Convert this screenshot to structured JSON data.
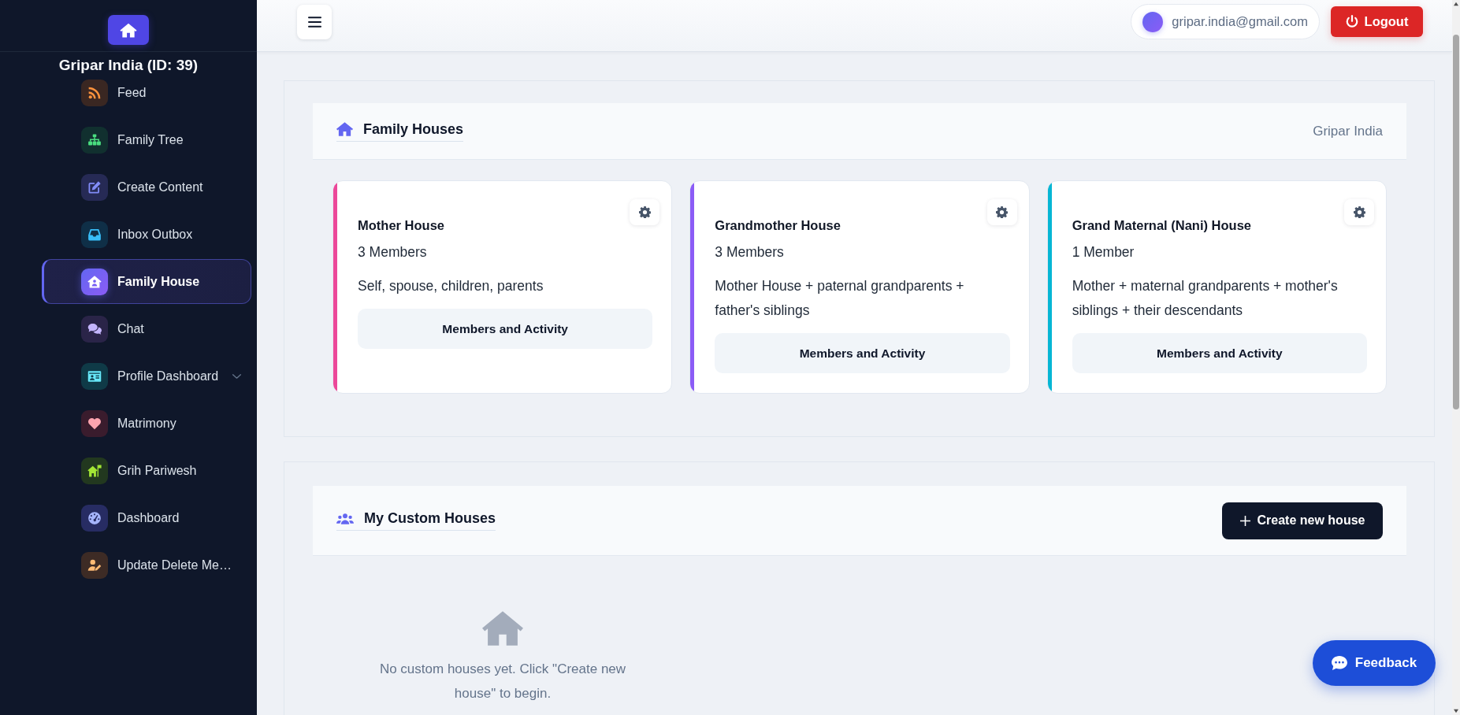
{
  "sidebar": {
    "title": "Gripar India (ID: 39)",
    "items": [
      {
        "label": "Feed",
        "selected": false,
        "has_submenu": false
      },
      {
        "label": "Family Tree",
        "selected": false,
        "has_submenu": false
      },
      {
        "label": "Create Content",
        "selected": false,
        "has_submenu": false
      },
      {
        "label": "Inbox Outbox",
        "selected": false,
        "has_submenu": false
      },
      {
        "label": "Family House",
        "selected": true,
        "has_submenu": false
      },
      {
        "label": "Chat",
        "selected": false,
        "has_submenu": false
      },
      {
        "label": "Profile Dashboard",
        "selected": false,
        "has_submenu": true
      },
      {
        "label": "Matrimony",
        "selected": false,
        "has_submenu": false
      },
      {
        "label": "Grih Pariwesh",
        "selected": false,
        "has_submenu": false
      },
      {
        "label": "Dashboard",
        "selected": false,
        "has_submenu": false
      },
      {
        "label": "Update Delete Me…",
        "selected": false,
        "has_submenu": false
      }
    ]
  },
  "header": {
    "user_email": "gripar.india@gmail.com",
    "logout": "Logout"
  },
  "family_houses": {
    "title": "Family Houses",
    "owner": "Gripar India",
    "cards": [
      {
        "name": "Mother House",
        "members": "3 Members",
        "description": "Self, spouse, children, parents",
        "button": "Members and Activity",
        "color": "#ec4899"
      },
      {
        "name": "Grandmother House",
        "members": "3 Members",
        "description": "Mother House + paternal grandparents + father's siblings",
        "button": "Members and Activity",
        "color": "#8b5cf6"
      },
      {
        "name": "Grand Maternal (Nani) House",
        "members": "1 Member",
        "description": "Mother + maternal grandparents + mother's siblings + their descendants",
        "button": "Members and Activity",
        "color": "#06b6d4"
      }
    ]
  },
  "custom_houses": {
    "title": "My Custom Houses",
    "create_button": "Create new house",
    "empty_message": "No custom houses yet. Click \"Create new house\" to begin."
  },
  "feedback_button": "Feedback"
}
